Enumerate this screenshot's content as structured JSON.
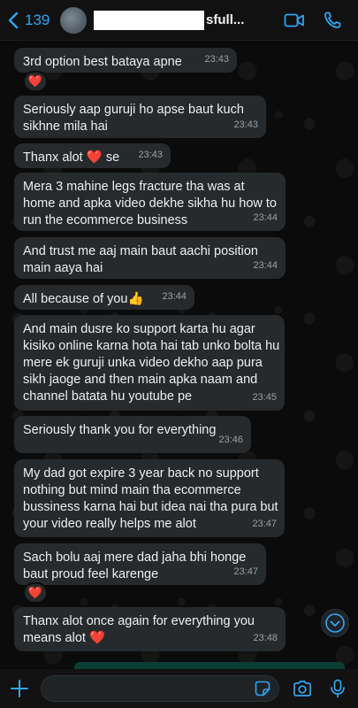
{
  "header": {
    "back_count": "139",
    "name_suffix": "sfull...",
    "accent_color": "#2fa6f1",
    "icons": [
      "chevron-left-icon",
      "video-call-icon",
      "phone-icon"
    ]
  },
  "messages": [
    {
      "text": "3rd option best bataya apne",
      "time": "23:43",
      "reaction": "❤️"
    },
    {
      "text": "Seriously aap guruji ho apse baut kuch sikhne mila hai",
      "time": "23:43"
    },
    {
      "text": "Thanx alot",
      "emoji": "❤️",
      "text_after": "se",
      "time": "23:43"
    },
    {
      "text": "Mera 3 mahine legs fracture tha was at home and apka video dekhe sikha hu how to run the ecommerce business",
      "time": "23:44"
    },
    {
      "text": "And trust me aaj main baut aachi position main aaya hai",
      "time": "23:44"
    },
    {
      "text": "All because of you",
      "emoji": "👍",
      "time": "23:44"
    },
    {
      "text": "And main dusre ko support karta hu agar kisiko online karna hota hai tab unko bolta hu mere ek guruji unka video dekho aap pura sikh jaoge and then main apka naam and channel batata hu youtube pe",
      "time": "23:45"
    },
    {
      "text": "Seriously thank you for everything",
      "time": "23:46"
    },
    {
      "text": "My dad got expire 3 year back no support nothing but mind main tha ecommerce bussiness karna hai but idea nai tha pura but your video really helps me alot",
      "time": "23:47"
    },
    {
      "text": "Sach bolu aaj mere dad jaha bhi honge baut proud feel karenge",
      "time": "23:47",
      "reaction": "❤️"
    },
    {
      "text": "Thanx alot once again for everything you means alot",
      "emoji": "❤️",
      "time": "23:48"
    }
  ],
  "input": {
    "placeholder": "",
    "icons": [
      "plus-icon",
      "sticker-icon",
      "camera-icon",
      "microphone-icon"
    ]
  },
  "colors": {
    "bubble": "#272a2c",
    "timestamp": "#9aa0a5",
    "heart": "#e53935"
  }
}
